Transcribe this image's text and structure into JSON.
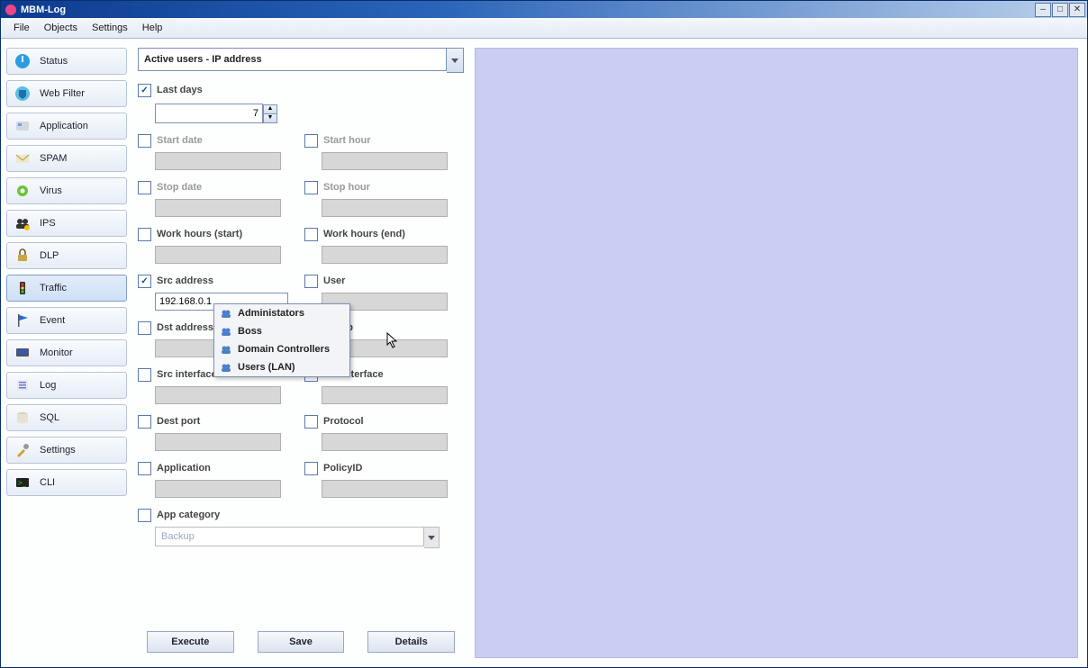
{
  "window_title": "MBM-Log",
  "menubar": [
    "File",
    "Objects",
    "Settings",
    "Help"
  ],
  "sidebar": {
    "items": [
      {
        "icon": "power",
        "label": "Status"
      },
      {
        "icon": "shield",
        "label": "Web Filter"
      },
      {
        "icon": "app",
        "label": "Application"
      },
      {
        "icon": "mail",
        "label": "SPAM"
      },
      {
        "icon": "gear",
        "label": "Virus"
      },
      {
        "icon": "users",
        "label": "IPS"
      },
      {
        "icon": "lock",
        "label": "DLP"
      },
      {
        "icon": "traffic",
        "label": "Traffic",
        "active": true
      },
      {
        "icon": "flag",
        "label": "Event"
      },
      {
        "icon": "monitor",
        "label": "Monitor"
      },
      {
        "icon": "log",
        "label": "Log"
      },
      {
        "icon": "db",
        "label": "SQL"
      },
      {
        "icon": "tools",
        "label": "Settings"
      },
      {
        "icon": "cli",
        "label": "CLI"
      }
    ]
  },
  "report_type": "Active users - IP address",
  "filters": {
    "last_days": {
      "label": "Last days",
      "checked": true,
      "value": "7"
    },
    "start_date": {
      "label": "Start date",
      "checked": false
    },
    "start_hour": {
      "label": "Start hour",
      "checked": false
    },
    "stop_date": {
      "label": "Stop date",
      "checked": false
    },
    "stop_hour": {
      "label": "Stop hour",
      "checked": false
    },
    "work_start": {
      "label": "Work hours (start)",
      "checked": false
    },
    "work_end": {
      "label": "Work hours (end)",
      "checked": false
    },
    "src_addr": {
      "label": "Src address",
      "checked": true,
      "value": "192.168.0.1"
    },
    "user": {
      "label": "User",
      "checked": false
    },
    "dst_addr": {
      "label": "Dst address",
      "checked": false
    },
    "group": {
      "label": "Group",
      "checked": false
    },
    "src_if": {
      "label": "Src interface",
      "checked": false
    },
    "dst_if": {
      "label": "Dst interface",
      "checked": false
    },
    "dest_port": {
      "label": "Dest port",
      "checked": false
    },
    "protocol": {
      "label": "Protocol",
      "checked": false
    },
    "application": {
      "label": "Application",
      "checked": false
    },
    "policyid": {
      "label": "PolicyID",
      "checked": false
    },
    "app_cat": {
      "label": "App category",
      "checked": false,
      "value": "Backup"
    }
  },
  "group_popup": [
    "Administators",
    "Boss",
    "Domain Controllers",
    "Users (LAN)"
  ],
  "buttons": {
    "execute": "Execute",
    "save": "Save",
    "details": "Details"
  }
}
